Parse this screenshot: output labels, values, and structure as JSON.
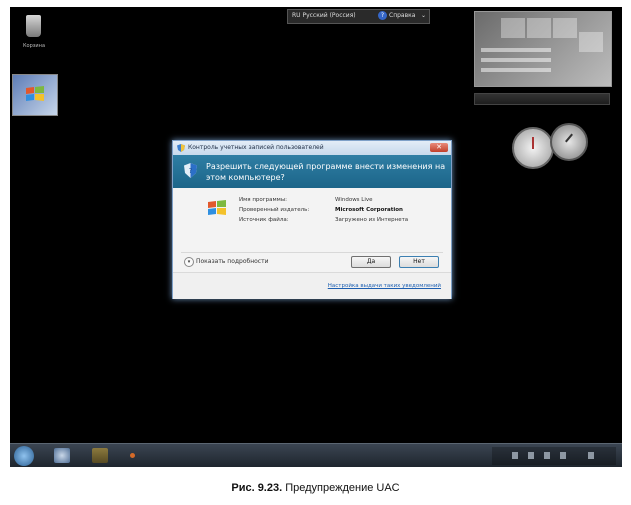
{
  "language_bar": {
    "language": "RU Русский (Россия)",
    "help": "Справка"
  },
  "desktop": {
    "recycle_bin_label": "Корзина"
  },
  "dialog": {
    "title": "Контроль учетных записей пользователей",
    "question": "Разрешить следующей программе внести изменения на этом компьютере?",
    "rows": [
      {
        "label": "Имя программы:",
        "value": "Windows Live",
        "bold": false
      },
      {
        "label": "Проверенный издатель:",
        "value": "Microsoft Corporation",
        "bold": true
      },
      {
        "label": "Источник файла:",
        "value": "Загружено из Интернета",
        "bold": false
      }
    ],
    "details_label": "Показать подробности",
    "yes_label": "Да",
    "no_label": "Нет",
    "settings_link": "Настройка выдачи таких уведомлений"
  },
  "caption": {
    "prefix": "Рис. 9.23.",
    "text": "Предупреждение UAC"
  }
}
